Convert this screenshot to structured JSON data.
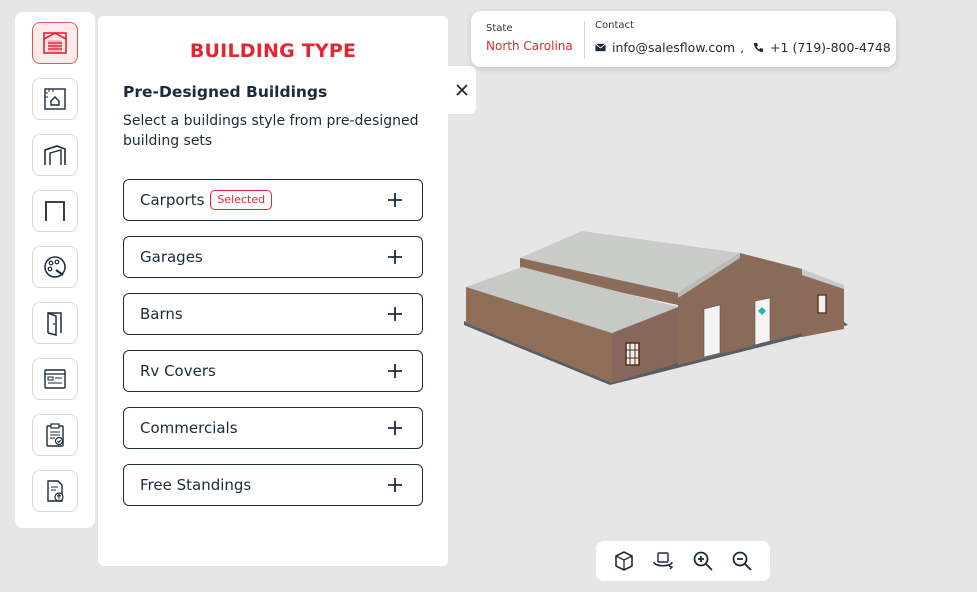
{
  "panel": {
    "title": "BUILDING TYPE",
    "section_title": "Pre-Designed Buildings",
    "section_desc": "Select a buildings style from pre-designed building sets",
    "categories": [
      {
        "label": "Carports",
        "badge": "Selected"
      },
      {
        "label": "Garages"
      },
      {
        "label": "Barns"
      },
      {
        "label": "Rv Covers"
      },
      {
        "label": "Commercials"
      },
      {
        "label": "Free Standings"
      }
    ]
  },
  "rail": {
    "icons": [
      "garage-icon",
      "blueprint-icon",
      "frame-icon",
      "door-frame-icon",
      "palette-icon",
      "door-icon",
      "window-icon",
      "checklist-icon",
      "upload-document-icon"
    ],
    "active_index": 0
  },
  "info": {
    "state_label": "State",
    "state_value": "North Carolina",
    "contact_label": "Contact",
    "email": "info@salesflow.com",
    "phone": "+1 (719)-800-4748"
  },
  "toolbar": {
    "icons": [
      "cube-view-icon",
      "rotate-360-icon",
      "zoom-in-icon",
      "zoom-out-icon"
    ]
  },
  "colors": {
    "accent": "#e3262f",
    "text": "#1c2b3a",
    "background": "#e6e6e6"
  }
}
